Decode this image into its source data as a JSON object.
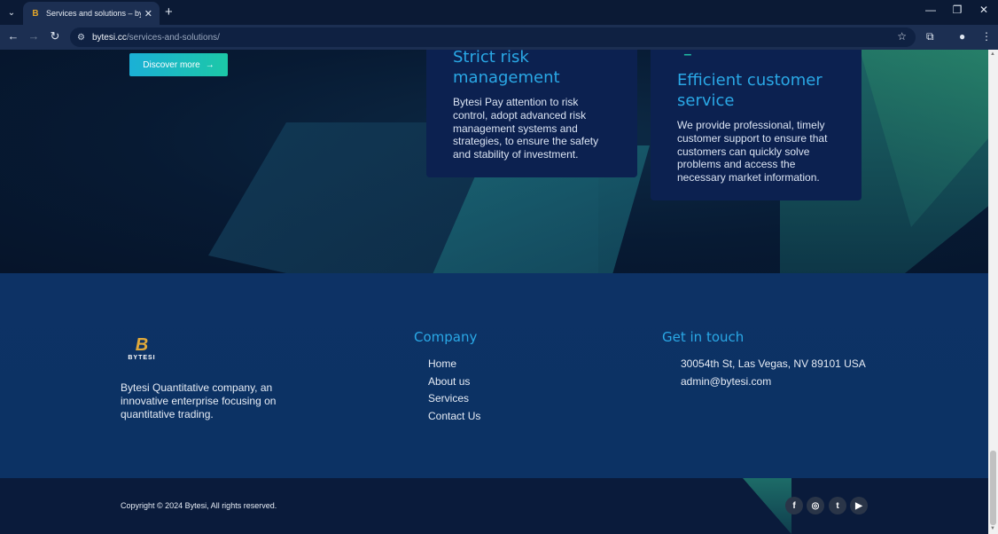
{
  "browser": {
    "tab_title": "Services and solutions – bytesi",
    "url_host": "bytesi.cc",
    "url_path": "/services-and-solutions/"
  },
  "hero": {
    "discover_label": "Discover more",
    "cards": [
      {
        "title": "Strict risk management",
        "text": "Bytesi Pay attention to risk control, adopt advanced risk management systems and strategies, to ensure the safety and stability of investment."
      },
      {
        "title": "Efficient customer service",
        "text": "We provide professional, timely customer support to ensure that customers can quickly solve problems and access the necessary market information."
      }
    ]
  },
  "footer": {
    "logo_text": "BYTESI",
    "about": "Bytesi Quantitative company, an innovative enterprise focusing on quantitative trading.",
    "company_title": "Company",
    "company_links": [
      "Home",
      "About us",
      "Services",
      "Contact Us"
    ],
    "contact_title": "Get in touch",
    "contact": [
      "30054th St, Las Vegas, NV 89101 USA",
      "admin@bytesi.com"
    ],
    "copyright": "Copyright © 2024 Bytesi, All rights reserved.",
    "social": [
      "facebook-icon",
      "instagram-icon",
      "twitter-icon",
      "youtube-icon"
    ]
  },
  "colors": {
    "accent_blue": "#2aa8e6",
    "button_gradient_start": "#1bb0d6",
    "button_gradient_end": "#1cc8a7",
    "footer_bg": "#0d3265"
  }
}
